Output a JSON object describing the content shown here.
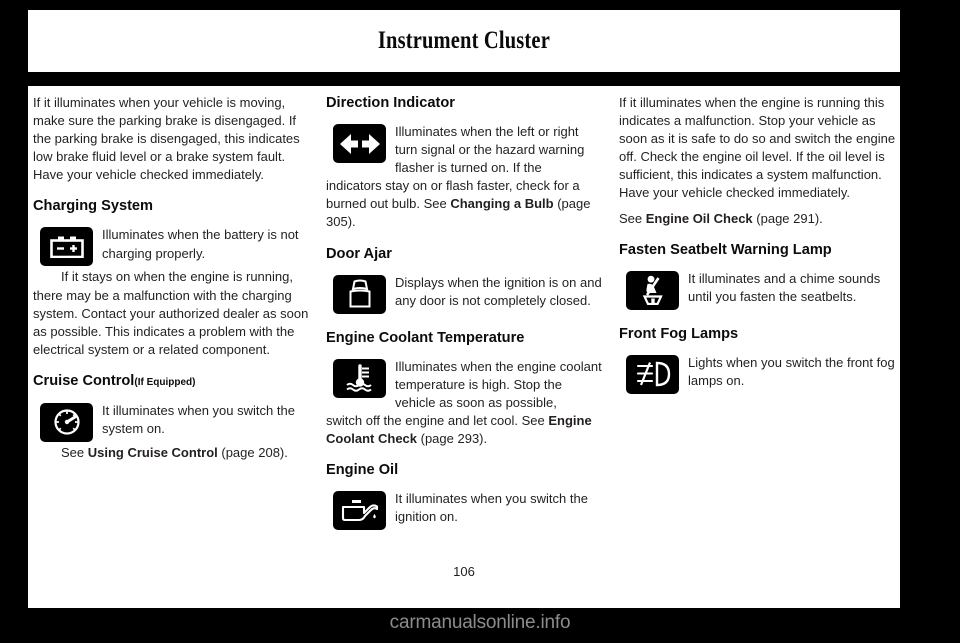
{
  "header": {
    "title": "Instrument Cluster"
  },
  "footer": {
    "page_number": "106",
    "watermark": "carmanualsonline.info"
  },
  "columns": [
    {
      "id": "column-left",
      "blocks": [
        {
          "type": "paragraph",
          "name": "brake-warning-paragraph",
          "text": "If it illuminates when your vehicle is moving, make sure the parking brake is disengaged. If the parking brake is disengaged, this indicates low brake fluid level or a brake system fault.  Have your vehicle checked immediately."
        },
        {
          "type": "heading",
          "name": "charging-system-heading",
          "text": "Charging System",
          "qualifier": ""
        },
        {
          "type": "symbol",
          "name": "charging-system-symbol-block",
          "icon": "battery-icon",
          "text": "Illuminates when the battery is not charging properly."
        },
        {
          "type": "paragraph",
          "name": "charging-system-detail-paragraph",
          "text": "If it stays on when the engine is running, there may be a malfunction with the charging system.  Contact your authorized dealer as soon as possible.  This indicates a problem with the electrical system or a related component."
        },
        {
          "type": "heading",
          "name": "cruise-control-heading",
          "text": "Cruise Control",
          "qualifier": "(If Equipped)"
        },
        {
          "type": "symbol",
          "name": "cruise-control-symbol-block",
          "icon": "speedometer-icon",
          "text": "It illuminates when you switch the system on."
        },
        {
          "type": "paragraph",
          "name": "cruise-control-reference-paragraph",
          "text_before": "See ",
          "bold": "Using Cruise Control",
          "text_after": " (page 208)."
        }
      ]
    },
    {
      "id": "column-middle",
      "blocks": [
        {
          "type": "heading",
          "name": "direction-indicator-heading",
          "text": "Direction Indicator",
          "qualifier": ""
        },
        {
          "type": "symbol",
          "name": "direction-indicator-symbol-block",
          "icon": "double-arrow-icon",
          "text": "Illuminates when the left or right turn signal or the hazard warning flasher is turned on. If the"
        },
        {
          "type": "paragraph",
          "name": "direction-indicator-detail-paragraph",
          "text_before": "indicators stay on or flash faster, check for a burned out bulb.  See ",
          "bold": "Changing a Bulb",
          "text_after": " (page 305)."
        },
        {
          "type": "heading",
          "name": "door-ajar-heading",
          "text": "Door Ajar",
          "qualifier": ""
        },
        {
          "type": "symbol",
          "name": "door-ajar-symbol-block",
          "icon": "car-door-open-icon",
          "text": "Displays when the ignition is on and any door is not completely closed."
        },
        {
          "type": "heading",
          "name": "engine-coolant-temperature-heading",
          "text": "Engine Coolant Temperature",
          "qualifier": ""
        },
        {
          "type": "symbol",
          "name": "engine-coolant-temperature-symbol-block",
          "icon": "coolant-thermometer-icon",
          "text": "Illuminates when the engine coolant temperature is high. Stop the vehicle as soon as possible,"
        },
        {
          "type": "paragraph",
          "name": "engine-coolant-detail-paragraph",
          "text_before": "switch off the engine and let cool.  See ",
          "bold": "Engine Coolant Check",
          "text_after": " (page 293)."
        },
        {
          "type": "heading",
          "name": "engine-oil-heading",
          "text": "Engine Oil",
          "qualifier": ""
        },
        {
          "type": "symbol",
          "name": "engine-oil-symbol-block",
          "icon": "oil-can-icon",
          "text": "It illuminates when you switch the ignition on."
        }
      ]
    },
    {
      "id": "column-right",
      "blocks": [
        {
          "type": "paragraph",
          "name": "engine-oil-warning-paragraph",
          "text": "If it illuminates when the engine is running this indicates a malfunction.  Stop your vehicle as soon as it is safe to do so and switch the engine off.  Check the engine oil level.  If the oil level is sufficient, this indicates a system malfunction.  Have your vehicle checked immediately."
        },
        {
          "type": "paragraph",
          "name": "engine-oil-reference-paragraph",
          "text_before": "See ",
          "bold": "Engine Oil Check",
          "text_after": " (page 291)."
        },
        {
          "type": "heading",
          "name": "fasten-seatbelt-warning-lamp-heading",
          "text": "Fasten Seatbelt Warning Lamp",
          "qualifier": ""
        },
        {
          "type": "symbol",
          "name": "fasten-seatbelt-symbol-block",
          "icon": "seatbelt-icon",
          "text": "It illuminates and a chime sounds until you fasten the seatbelts."
        },
        {
          "type": "heading",
          "name": "front-fog-lamps-heading",
          "text": "Front Fog Lamps",
          "qualifier": ""
        },
        {
          "type": "symbol",
          "name": "front-fog-lamps-symbol-block",
          "icon": "fog-lamp-icon",
          "text": "Lights when you switch the front fog lamps on."
        }
      ]
    }
  ],
  "colors": {
    "page_background": "#000000",
    "sheet": "#ffffff",
    "text": "#231f20",
    "symbol_background": "#000000",
    "watermark": "#8c8c8c"
  }
}
